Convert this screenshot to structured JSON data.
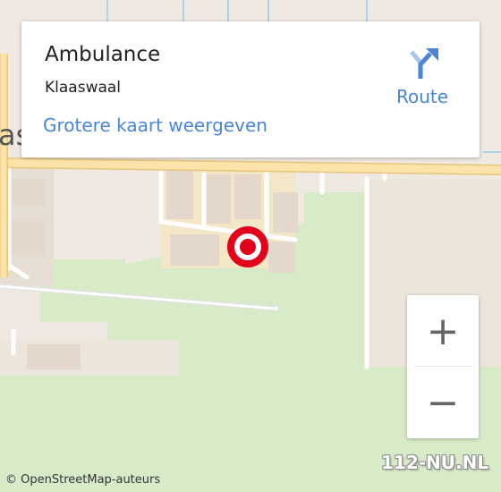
{
  "colors": {
    "map_background": "#efe9e1",
    "grass": "#d8ebc9",
    "residential": "#ece5dc",
    "road_major": "#fbe3a9",
    "road_casing": "#e7c57c",
    "road_minor": "#ffffff",
    "water": "#a9d3e8",
    "marker": "#e3001b",
    "link": "#4a86d8",
    "route_icon_dark": "#4a86d8",
    "route_icon_light": "#a9c7ee"
  },
  "info_card": {
    "title": "Ambulance",
    "subtitle": "Klaaswaal",
    "link_label": "Grotere kaart weergeven",
    "route_label": "Route",
    "route_icon": "directions-turn-right-icon"
  },
  "map": {
    "partial_place_label": "as",
    "marker_icon": "target-location-icon"
  },
  "zoom": {
    "in_label": "+",
    "out_label": "−"
  },
  "attribution": "© OpenStreetMap-auteurs",
  "watermark": "112-NU.NL"
}
